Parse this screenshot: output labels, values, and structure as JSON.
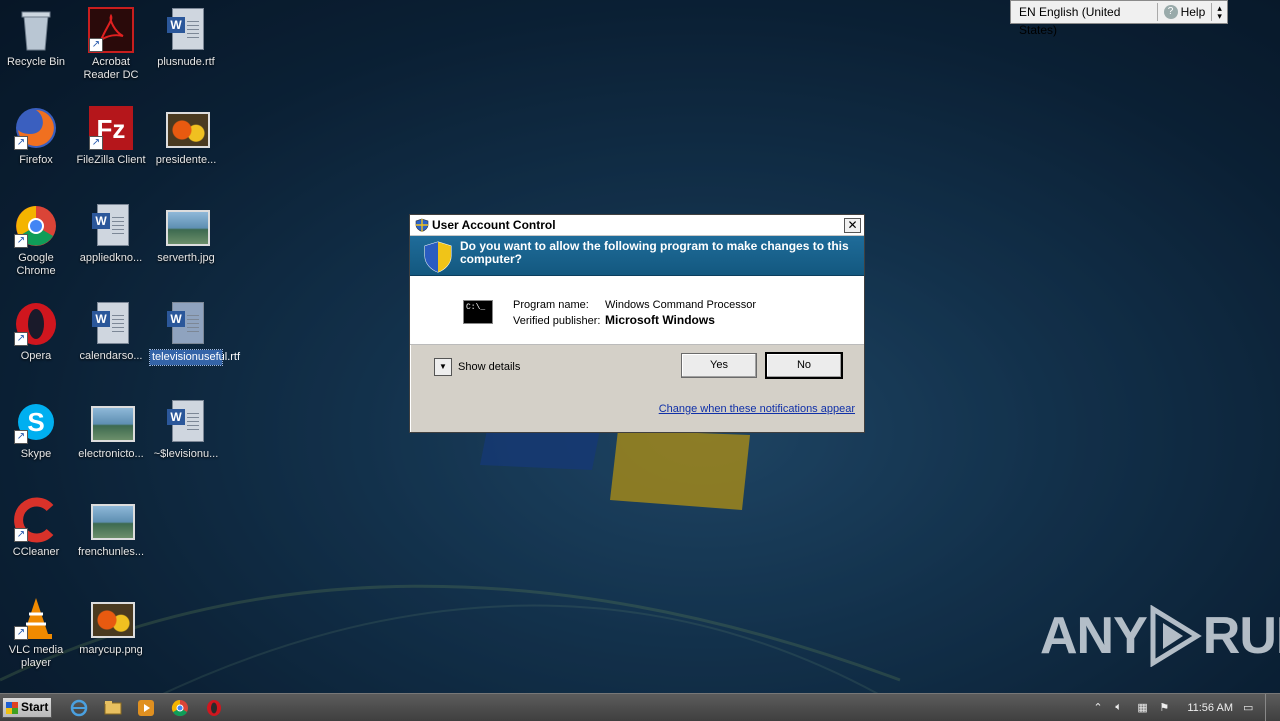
{
  "desktop": {
    "icons": [
      {
        "label": "Recycle Bin"
      },
      {
        "label": "Acrobat Reader DC"
      },
      {
        "label": "plusnude.rtf"
      },
      {
        "label": "Firefox"
      },
      {
        "label": "FileZilla Client"
      },
      {
        "label": "presidente..."
      },
      {
        "label": "Google Chrome"
      },
      {
        "label": "appliedkno..."
      },
      {
        "label": "serverth.jpg"
      },
      {
        "label": "Opera"
      },
      {
        "label": "calendarso..."
      },
      {
        "label": "televisionuseful.rtf"
      },
      {
        "label": "Skype"
      },
      {
        "label": "electronicto..."
      },
      {
        "label": "~$levisionu..."
      },
      {
        "label": "CCleaner"
      },
      {
        "label": "frenchunles..."
      },
      {
        "label": "VLC media player"
      },
      {
        "label": "marycup.png"
      }
    ]
  },
  "language_bar": {
    "language": "EN English (United States)",
    "help": "Help"
  },
  "uac": {
    "title": "User Account Control",
    "close": "✕",
    "question": "Do you want to allow the following program to make changes to this computer?",
    "program_name_label": "Program name:",
    "program_name": "Windows Command Processor",
    "publisher_label": "Verified publisher:",
    "publisher": "Microsoft Windows",
    "cmd_text": "C:\\_",
    "show_details": "Show details",
    "yes": "Yes",
    "no": "No",
    "link": "Change when these notifications appear"
  },
  "watermark": {
    "brand_left": "ANY",
    "brand_right": "RUN"
  },
  "taskbar": {
    "start": "Start",
    "clock": "11:56 AM"
  },
  "colors": {
    "banner": "#1a6491",
    "link": "#1030a8",
    "selected": "#3464a8"
  }
}
